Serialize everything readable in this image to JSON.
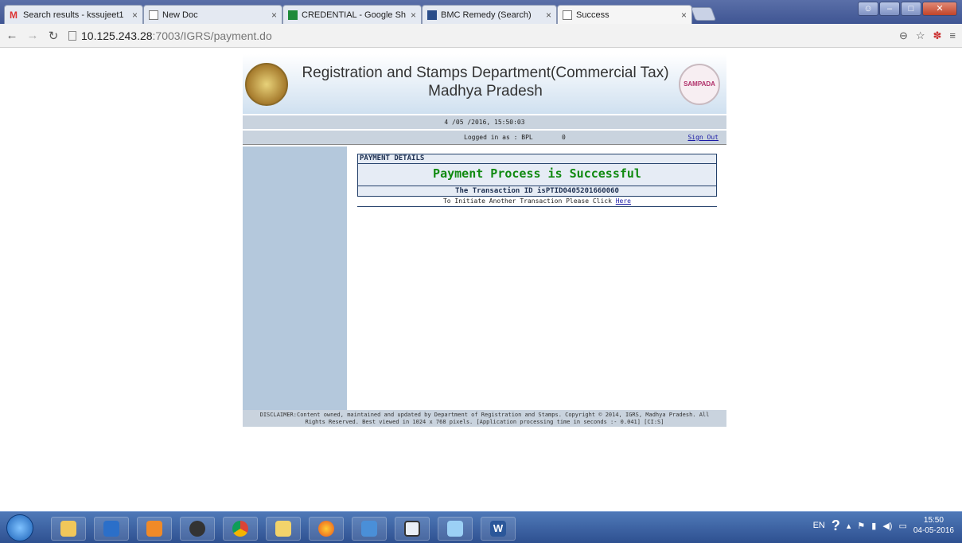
{
  "browser": {
    "tabs": [
      {
        "label": "Search results - kssujeet1",
        "icon": "gmail-icon",
        "active": false
      },
      {
        "label": "New Doc",
        "icon": "doc-icon",
        "active": false
      },
      {
        "label": "CREDENTIAL - Google Sh",
        "icon": "sheets-icon",
        "active": false
      },
      {
        "label": "BMC Remedy (Search)",
        "icon": "bmc-icon",
        "active": false
      },
      {
        "label": "Success",
        "icon": "doc-icon",
        "active": true
      }
    ],
    "url_host": "10.125.243.28",
    "url_rest": ":7003/IGRS/payment.do"
  },
  "header": {
    "title_line1": "Registration and Stamps Department(Commercial Tax)",
    "title_line2": "Madhya Pradesh",
    "logo_right_text": "SAMPADA"
  },
  "status": {
    "datetime": "4 /05 /2016, 15:50:03",
    "logged_in_label": "Logged in as : BPL",
    "logged_in_value": "0",
    "sign_out": "Sign Out"
  },
  "payment": {
    "section_title": "PAYMENT DETAILS",
    "message": "Payment Process is Successful",
    "transaction_text": "The Transaction ID isPTID0405201660060",
    "initiate_text": "To Initiate Another Transaction Please Click",
    "initiate_link": "Here"
  },
  "footer": {
    "disclaimer_line1": "DISCLAIMER:Content owned, maintained and updated by Department of Registration and Stamps. Copyright © 2014, IGRS, Madhya Pradesh. All",
    "disclaimer_line2": "Rights Reserved. Best viewed in 1024 x 768 pixels. [Application processing time in seconds :- 0.041] [CI:S]"
  },
  "taskbar": {
    "language": "EN",
    "time": "15:50",
    "date": "04-05-2016",
    "apps": [
      "explorer-icon",
      "media-player-icon",
      "uc-browser-icon",
      "webcam-icon",
      "chrome-icon",
      "folder-icon",
      "firefox-icon",
      "app-icon",
      "window-icon",
      "network-icon",
      "word-icon"
    ]
  },
  "colors": {
    "success_green": "#108a10",
    "sidebar_blue": "#b4c8dc",
    "header_bar": "#c9d3de"
  }
}
